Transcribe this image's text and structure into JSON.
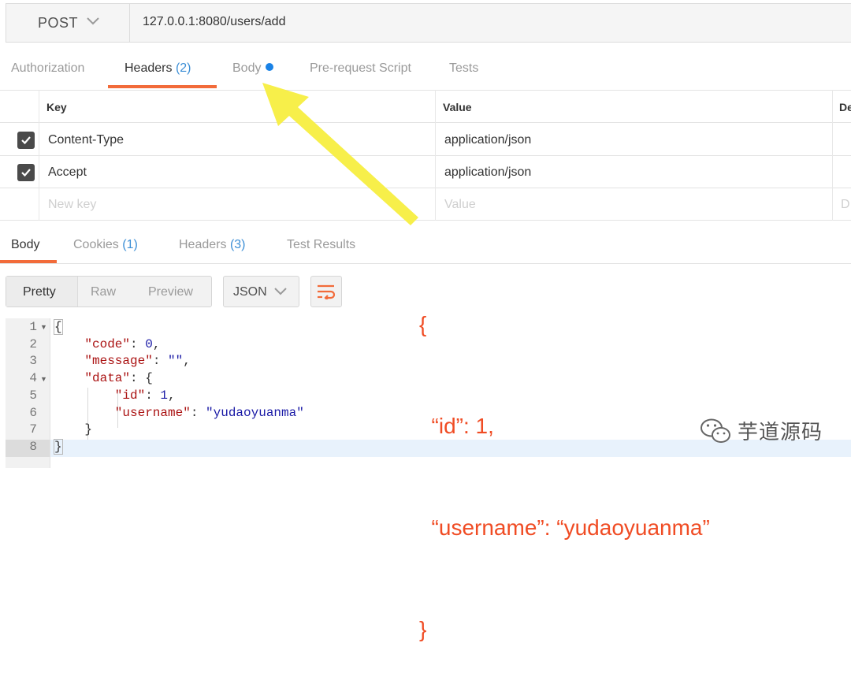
{
  "request": {
    "method": "POST",
    "url": "127.0.0.1:8080/users/add"
  },
  "request_tabs": [
    {
      "label": "Authorization",
      "count": ""
    },
    {
      "label": "Headers",
      "count": "(2)"
    },
    {
      "label": "Body",
      "count": ""
    },
    {
      "label": "Pre-request Script",
      "count": ""
    },
    {
      "label": "Tests",
      "count": ""
    }
  ],
  "headers_table": {
    "columns": [
      "Key",
      "Value",
      "De"
    ],
    "rows": [
      {
        "key": "Content-Type",
        "value": "application/json",
        "checked": true
      },
      {
        "key": "Accept",
        "value": "application/json",
        "checked": true
      }
    ],
    "new_row": {
      "key_placeholder": "New key",
      "value_placeholder": "Value",
      "desc_placeholder": "D"
    }
  },
  "response_tabs": [
    {
      "label": "Body",
      "count": ""
    },
    {
      "label": "Cookies",
      "count": "(1)"
    },
    {
      "label": "Headers",
      "count": "(3)"
    },
    {
      "label": "Test Results",
      "count": ""
    }
  ],
  "toolbar": {
    "views": [
      "Pretty",
      "Raw",
      "Preview"
    ],
    "format": "JSON"
  },
  "code": {
    "line_numbers": [
      "1",
      "2",
      "3",
      "4",
      "5",
      "6",
      "7",
      "8"
    ],
    "lines": [
      {
        "parts": [
          {
            "t": "{",
            "c": "p"
          }
        ]
      },
      {
        "parts": [
          {
            "t": "\"code\"",
            "c": "k"
          },
          {
            "t": ": ",
            "c": "p"
          },
          {
            "t": "0",
            "c": "n"
          },
          {
            "t": ",",
            "c": "p"
          }
        ]
      },
      {
        "parts": [
          {
            "t": "\"message\"",
            "c": "k"
          },
          {
            "t": ": ",
            "c": "p"
          },
          {
            "t": "\"\"",
            "c": "s"
          },
          {
            "t": ",",
            "c": "p"
          }
        ]
      },
      {
        "parts": [
          {
            "t": "\"data\"",
            "c": "k"
          },
          {
            "t": ": {",
            "c": "p"
          }
        ]
      },
      {
        "parts": [
          {
            "t": "\"id\"",
            "c": "k"
          },
          {
            "t": ": ",
            "c": "p"
          },
          {
            "t": "1",
            "c": "n"
          },
          {
            "t": ",",
            "c": "p"
          }
        ]
      },
      {
        "parts": [
          {
            "t": "\"username\"",
            "c": "k"
          },
          {
            "t": ": ",
            "c": "p"
          },
          {
            "t": "\"yudaoyuanma\"",
            "c": "s"
          }
        ]
      },
      {
        "parts": [
          {
            "t": "}",
            "c": "p"
          }
        ]
      },
      {
        "parts": [
          {
            "t": "}",
            "c": "p"
          }
        ]
      }
    ]
  },
  "annotation": {
    "lines": [
      "{",
      "  “id”: 1,",
      "  “username”: “yudaoyuanma”",
      "}"
    ],
    "color": "#f04c24"
  },
  "watermark": {
    "text": "芋道源码",
    "icon": "wechat-icon"
  },
  "colors": {
    "accent": "#f26b3a",
    "count_blue": "#3d8fd6",
    "body_dot": "#1a82e6",
    "arrow": "#f7ef4a"
  }
}
